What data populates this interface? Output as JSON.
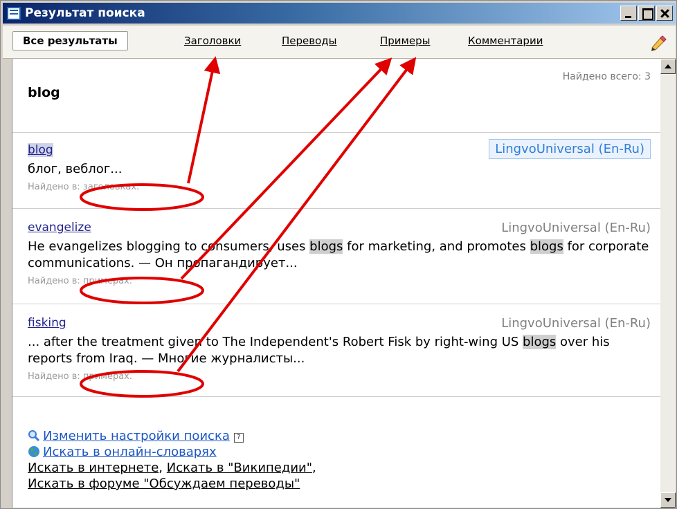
{
  "window": {
    "title": "Результат поиска"
  },
  "tabs": [
    {
      "label": "Все результаты"
    },
    {
      "label": "Заголовки"
    },
    {
      "label": "Переводы"
    },
    {
      "label": "Примеры"
    },
    {
      "label": "Комментарии"
    }
  ],
  "summary": {
    "found_total": "Найдено всего: 3",
    "query": "blog"
  },
  "results": [
    {
      "title": "blog",
      "dictionary": "LingvoUniversal (En-Ru)",
      "text": "блог, веблог...",
      "found": "Найдено в: заголовках."
    },
    {
      "title": "evangelize",
      "dictionary": "LingvoUniversal (En-Ru)",
      "text_parts": [
        "He evangelizes blogging to consumers, uses ",
        "blogs",
        " for marketing, and promotes ",
        "blogs",
        " for corporate communications. — Он пропагандирует..."
      ],
      "found": "Найдено в: примерах."
    },
    {
      "title": "fisking",
      "dictionary": "LingvoUniversal (En-Ru)",
      "text_parts": [
        "... after the treatment given to The Independent's Robert Fisk by right-wing US ",
        "blogs",
        " over his reports from Iraq. — Многие журналисты..."
      ],
      "found": "Найдено в: примерах."
    }
  ],
  "links": {
    "change_settings": "Изменить настройки поиска",
    "search_online": "Искать в онлайн-словарях",
    "search_internet": "Искать в интернете",
    "sep": ",",
    "search_wiki": "Искать в \"Википедии\"",
    "sep2": ",",
    "search_forum": "Искать в форуме \"Обсуждаем переводы\""
  },
  "colors": {
    "annotation_red": "#e00000",
    "link_blue": "#1c57c4",
    "title_bar": "#0a246a"
  },
  "icons": [
    "app-icon",
    "minimize-icon",
    "maximize-icon",
    "close-icon",
    "pen-icon",
    "search-icon",
    "globe-icon",
    "help-icon",
    "scroll-up-icon",
    "scroll-down-icon"
  ]
}
